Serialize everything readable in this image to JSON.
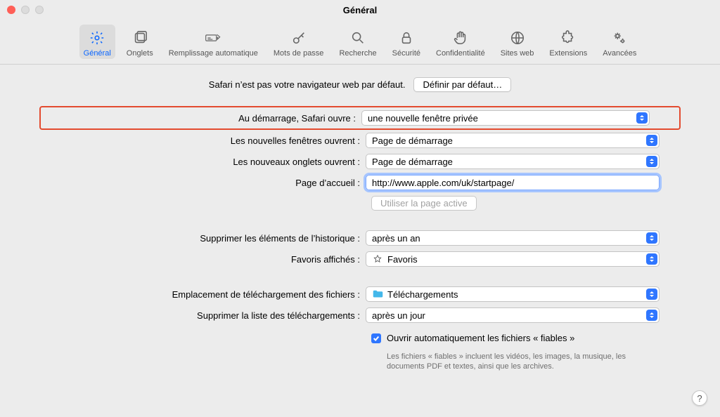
{
  "window": {
    "title": "Général"
  },
  "toolbar": [
    {
      "key": "general",
      "label": "Général",
      "icon": "gear-icon",
      "active": true
    },
    {
      "key": "tabs",
      "label": "Onglets",
      "icon": "tabs-icon"
    },
    {
      "key": "autofill",
      "label": "Remplissage automatique",
      "icon": "autofill-icon"
    },
    {
      "key": "passwords",
      "label": "Mots de passe",
      "icon": "key-icon"
    },
    {
      "key": "search",
      "label": "Recherche",
      "icon": "search-icon"
    },
    {
      "key": "security",
      "label": "Sécurité",
      "icon": "lock-icon"
    },
    {
      "key": "privacy",
      "label": "Confidentialité",
      "icon": "hand-icon"
    },
    {
      "key": "websites",
      "label": "Sites web",
      "icon": "globe-icon"
    },
    {
      "key": "extensions",
      "label": "Extensions",
      "icon": "puzzle-icon"
    },
    {
      "key": "advanced",
      "label": "Avancées",
      "icon": "gears-icon"
    }
  ],
  "defaultBrowser": {
    "text": "Safari n’est pas votre navigateur web par défaut.",
    "button": "Définir par défaut…"
  },
  "form": {
    "startup": {
      "label": "Au démarrage, Safari ouvre :",
      "value": "une nouvelle fenêtre privée"
    },
    "newWindows": {
      "label": "Les nouvelles fenêtres ouvrent :",
      "value": "Page de démarrage"
    },
    "newTabs": {
      "label": "Les nouveaux onglets ouvrent :",
      "value": "Page de démarrage"
    },
    "homepage": {
      "label": "Page d’accueil :",
      "value": "http://www.apple.com/uk/startpage/"
    },
    "setToCurrent": {
      "button": "Utiliser la page active"
    },
    "historyRemove": {
      "label": "Supprimer les éléments de l’historique :",
      "value": "après un an"
    },
    "favoritesShown": {
      "label": "Favoris affichés :",
      "value": "Favoris"
    },
    "downloadLoc": {
      "label": "Emplacement de téléchargement des fichiers :",
      "value": "Téléchargements"
    },
    "downloadsRemove": {
      "label": "Supprimer la liste des téléchargements :",
      "value": "après un jour"
    },
    "safeFiles": {
      "label": "Ouvrir automatiquement les fichiers « fiables »",
      "checked": true,
      "help": "Les fichiers « fiables » incluent les vidéos, les images, la musique, les documents PDF et textes, ainsi que les archives."
    }
  },
  "helpButton": "?"
}
